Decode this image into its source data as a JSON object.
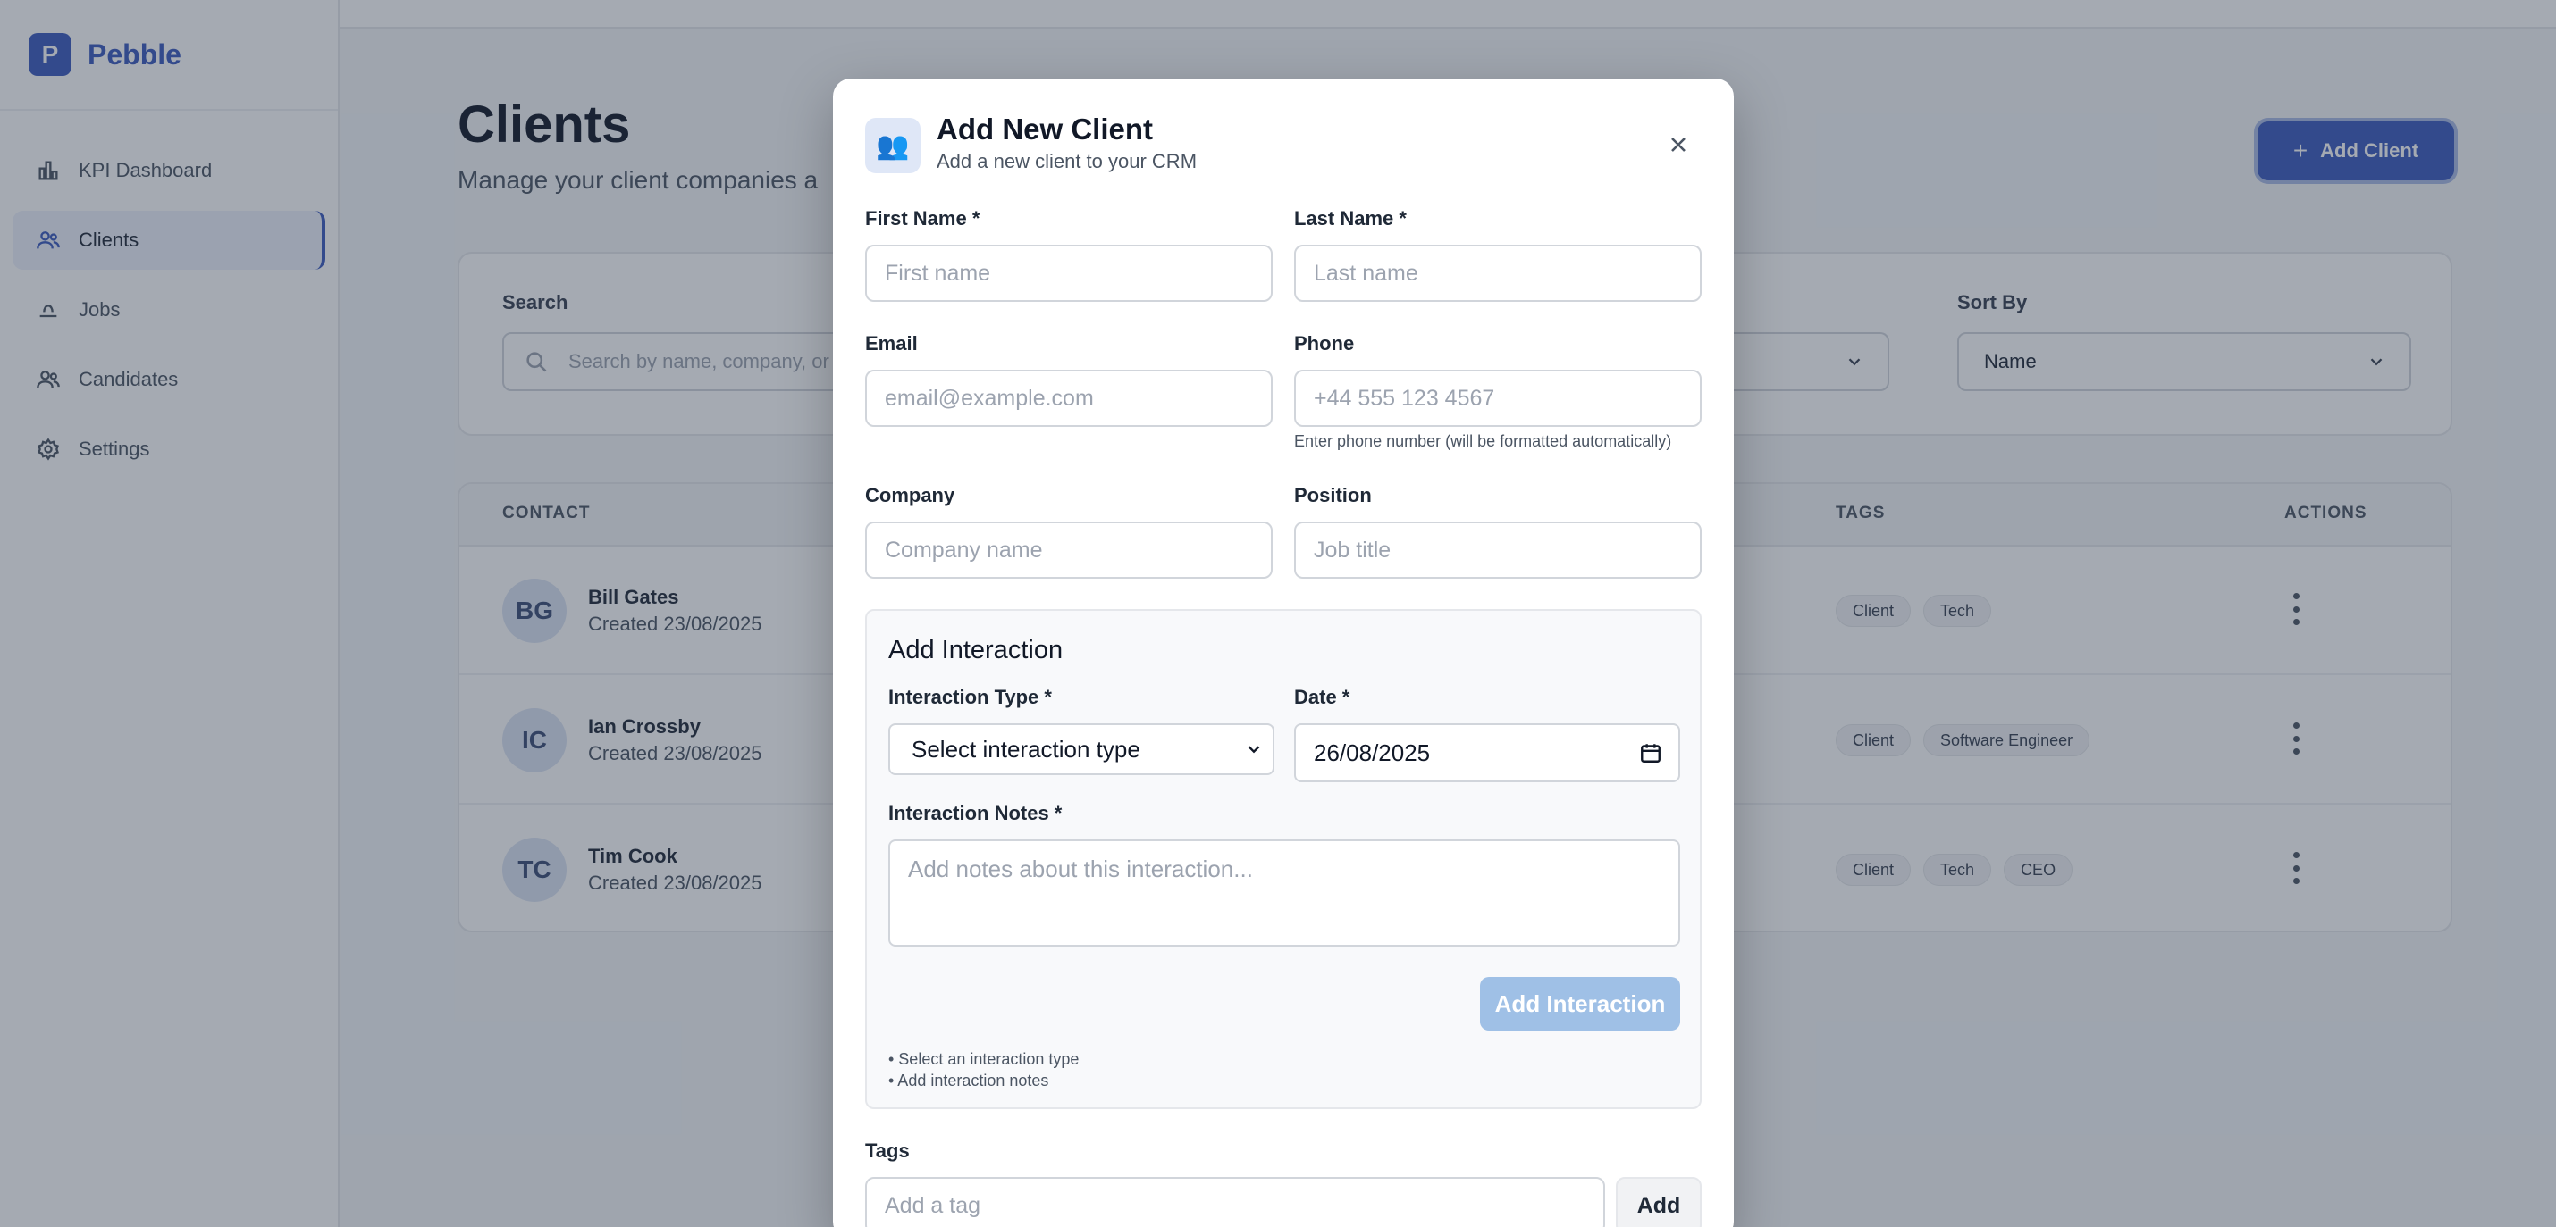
{
  "brand": {
    "logo_letter": "P",
    "name": "Pebble",
    "color": "#3b5bbd"
  },
  "sidebar": {
    "items": [
      {
        "label": "KPI Dashboard",
        "icon": "bar-chart-icon"
      },
      {
        "label": "Clients",
        "icon": "users-icon",
        "active": true
      },
      {
        "label": "Jobs",
        "icon": "briefcase-icon"
      },
      {
        "label": "Candidates",
        "icon": "people-icon"
      },
      {
        "label": "Settings",
        "icon": "gear-icon"
      }
    ]
  },
  "page": {
    "title": "Clients",
    "subtitle": "Manage your client companies a",
    "add_button": "Add Client"
  },
  "filters": {
    "search_label": "Search",
    "search_placeholder": "Search by name, company, or",
    "sort_label": "Sort By",
    "sort_value": "Name"
  },
  "table": {
    "headers": {
      "contact": "CONTACT",
      "tags": "TAGS",
      "actions": "ACTIONS"
    },
    "rows": [
      {
        "initials": "BG",
        "name": "Bill Gates",
        "created": "Created 23/08/2025",
        "tags": [
          "Client",
          "Tech"
        ]
      },
      {
        "initials": "IC",
        "name": "Ian Crossby",
        "created": "Created 23/08/2025",
        "tags": [
          "Client",
          "Software Engineer"
        ]
      },
      {
        "initials": "TC",
        "name": "Tim Cook",
        "created": "Created 23/08/2025",
        "tags": [
          "Client",
          "Tech",
          "CEO"
        ]
      }
    ]
  },
  "modal": {
    "icon": "users-emoji-icon",
    "title": "Add New Client",
    "subtitle": "Add a new client to your CRM",
    "first_name": {
      "label": "First Name *",
      "placeholder": "First name"
    },
    "last_name": {
      "label": "Last Name *",
      "placeholder": "Last name"
    },
    "email": {
      "label": "Email",
      "placeholder": "email@example.com"
    },
    "phone": {
      "label": "Phone",
      "placeholder": "+44 555 123 4567",
      "hint": "Enter phone number (will be formatted automatically)"
    },
    "company": {
      "label": "Company",
      "placeholder": "Company name"
    },
    "position": {
      "label": "Position",
      "placeholder": "Job title"
    },
    "interaction": {
      "title": "Add Interaction",
      "type_label": "Interaction Type *",
      "type_value": "Select interaction type",
      "date_label": "Date *",
      "date_value": "26/08/2025",
      "notes_label": "Interaction Notes *",
      "notes_placeholder": "Add notes about this interaction...",
      "button": "Add Interaction",
      "requirements": [
        "• Select an interaction type",
        "• Add interaction notes"
      ]
    },
    "tags": {
      "label": "Tags",
      "placeholder": "Add a tag",
      "button": "Add"
    }
  }
}
